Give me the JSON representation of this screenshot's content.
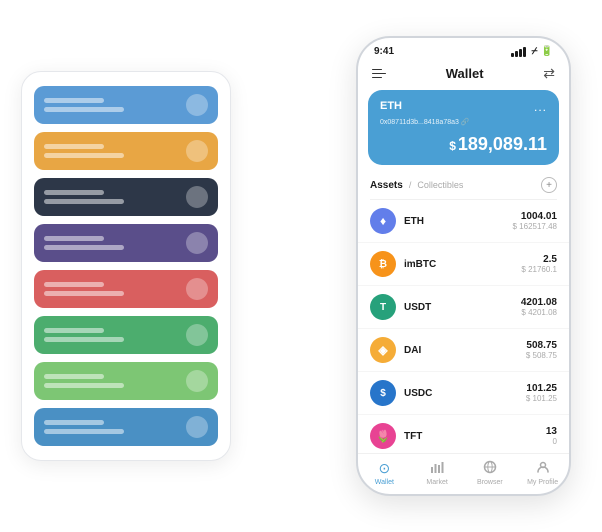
{
  "scene": {
    "left_panel": {
      "cards": [
        {
          "color": "blue",
          "id": "card-1"
        },
        {
          "color": "orange",
          "id": "card-2"
        },
        {
          "color": "dark",
          "id": "card-3"
        },
        {
          "color": "purple",
          "id": "card-4"
        },
        {
          "color": "red",
          "id": "card-5"
        },
        {
          "color": "green",
          "id": "card-6"
        },
        {
          "color": "light-green",
          "id": "card-7"
        },
        {
          "color": "blue2",
          "id": "card-8"
        }
      ]
    },
    "phone": {
      "status": {
        "time": "9:41",
        "battery": "▐",
        "wifi": "▲"
      },
      "header": {
        "menu_icon_label": "menu",
        "title": "Wallet",
        "expand_icon": "⇄"
      },
      "eth_card": {
        "label": "ETH",
        "address": "0x08711d3b...8418a78a3 🔗",
        "dots": "...",
        "balance_symbol": "$",
        "balance": "189,089.11"
      },
      "tabs": {
        "active": "Assets",
        "separator": "/",
        "inactive": "Collectibles",
        "add_label": "+"
      },
      "assets": [
        {
          "name": "ETH",
          "icon_type": "eth",
          "symbol": "♦",
          "amount": "1004.01",
          "usd": "$ 162517.48"
        },
        {
          "name": "imBTC",
          "icon_type": "imbtc",
          "symbol": "₿",
          "amount": "2.5",
          "usd": "$ 21760.1"
        },
        {
          "name": "USDT",
          "icon_type": "usdt",
          "symbol": "T",
          "amount": "4201.08",
          "usd": "$ 4201.08"
        },
        {
          "name": "DAI",
          "icon_type": "dai",
          "symbol": "◈",
          "amount": "508.75",
          "usd": "$ 508.75"
        },
        {
          "name": "USDC",
          "icon_type": "usdc",
          "symbol": "©",
          "amount": "101.25",
          "usd": "$ 101.25"
        },
        {
          "name": "TFT",
          "icon_type": "tft",
          "symbol": "🌷",
          "amount": "13",
          "usd": "0"
        }
      ],
      "bottom_nav": [
        {
          "label": "Wallet",
          "active": true,
          "icon": "⊙"
        },
        {
          "label": "Market",
          "active": false,
          "icon": "📊"
        },
        {
          "label": "Browser",
          "active": false,
          "icon": "🌐"
        },
        {
          "label": "My Profile",
          "active": false,
          "icon": "👤"
        }
      ]
    }
  }
}
